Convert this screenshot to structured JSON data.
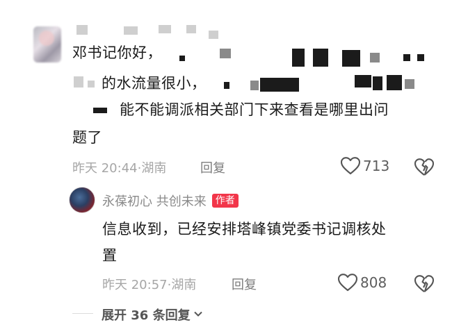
{
  "comment": {
    "line1": "邓书记你好，",
    "line2": "的水流量很小，",
    "line3": "能不能调派相关部门下来查看是哪里出问",
    "line4": "题了",
    "time": "昨天 20:44·湖南",
    "reply_label": "回复",
    "likes": "713"
  },
  "reply": {
    "name": "永葆初心 共创未来",
    "badge": "作者",
    "line1": "信息收到，已经安排塔峰镇党委书记调核处",
    "line2": "置",
    "time": "昨天 20:57·湖南",
    "reply_label": "回复",
    "likes": "808"
  },
  "expand": {
    "label": "展开 36 条回复"
  },
  "icons": {
    "like": "heart-outline-icon",
    "dislike": "broken-heart-icon",
    "expand": "chevron-down-icon"
  }
}
